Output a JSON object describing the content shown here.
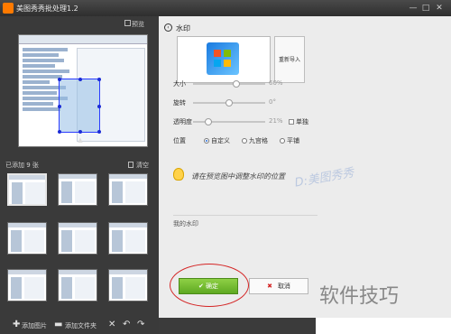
{
  "window": {
    "title": "美图秀秀批处理1.2",
    "minimize": "—",
    "maximize": "□",
    "close": "✕"
  },
  "left": {
    "preview_label": "预览",
    "added_label": "已添加 9 张",
    "clear_label": "清空",
    "thumbnail_count": 9,
    "add_image_label": "添加图片",
    "add_folder_label": "添加文件夹"
  },
  "dialog": {
    "title": "水印",
    "reimport_label": "重新导入",
    "sliders": [
      {
        "label": "大小",
        "value_text": "60%",
        "value": 0.6
      },
      {
        "label": "旋转",
        "value_text": "0°",
        "value": 0.5
      },
      {
        "label": "透明度",
        "value_text": "21%",
        "value": 0.21
      }
    ],
    "single_label": "单独",
    "position_label": "位置",
    "position_options": [
      {
        "label": "自定义",
        "selected": true
      },
      {
        "label": "九宫格",
        "selected": false
      },
      {
        "label": "平铺",
        "selected": false
      }
    ],
    "tip_text": "请在预览图中调整水印的位置",
    "my_watermark_label": "我的水印",
    "ok_label": "确定",
    "cancel_label": "取消"
  },
  "overlay": {
    "site_stamp": "D:美图秀秀",
    "corner_text": "软件技巧"
  },
  "colors": {
    "ok_green": "#6cbc2a",
    "annotation_red": "#d42424",
    "panel_dark": "#3a3a3a"
  }
}
